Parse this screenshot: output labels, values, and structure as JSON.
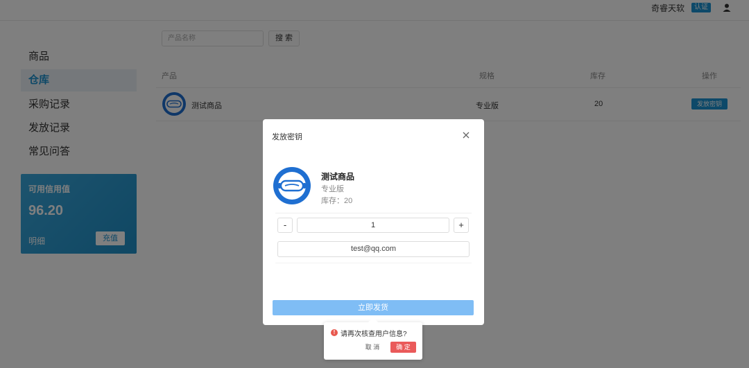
{
  "header": {
    "company": "奇睿天软",
    "verify_badge": "认证",
    "user_icon": "user-icon"
  },
  "sidebar": {
    "items": [
      {
        "label": "商品",
        "active": false
      },
      {
        "label": "仓库",
        "active": true
      },
      {
        "label": "采购记录",
        "active": false
      },
      {
        "label": "发放记录",
        "active": false
      },
      {
        "label": "常见问答",
        "active": false
      }
    ],
    "credit": {
      "title": "可用信用值",
      "value": "96.20",
      "detail_label": "明细",
      "recharge_label": "充值"
    }
  },
  "search": {
    "placeholder": "产品名称",
    "button_label": "搜 索"
  },
  "table": {
    "columns": [
      "产品",
      "规格",
      "库存",
      "操作"
    ],
    "rows": [
      {
        "product": "测试商品",
        "spec": "专业版",
        "stock": "20",
        "action": "发放密钥"
      }
    ]
  },
  "dialog": {
    "title": "发放密钥",
    "product_name": "测试商品",
    "product_spec": "专业版",
    "product_stock": "库存：20",
    "minus_label": "-",
    "plus_label": "+",
    "quantity": "1",
    "email": "test@qq.com",
    "submit_label": "立即发货"
  },
  "popconfirm": {
    "message": "请再次核查用户信息?",
    "cancel_label": "取 消",
    "confirm_label": "确 定"
  },
  "colors": {
    "accent": "#1a93d2",
    "submit": "#7fbdf5",
    "danger": "#ea5a5a",
    "logo": "#1f6fd1"
  }
}
